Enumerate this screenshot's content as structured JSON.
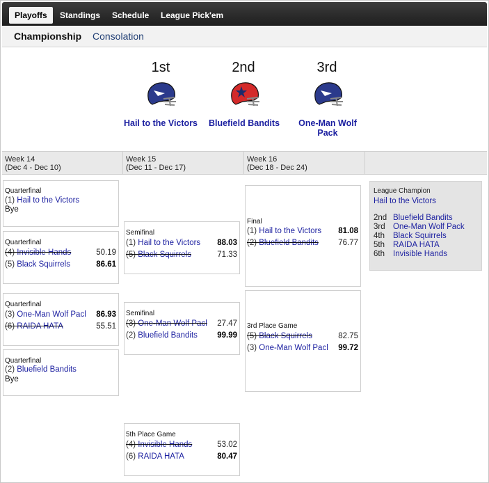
{
  "nav": {
    "tabs": [
      "Playoffs",
      "Standings",
      "Schedule",
      "League Pick'em"
    ]
  },
  "subnav": {
    "active": "Championship",
    "other": "Consolation"
  },
  "podium": [
    {
      "rank": "1st",
      "team": "Hail to the Victors",
      "helmet": "navy"
    },
    {
      "rank": "2nd",
      "team": "Bluefield Bandits",
      "helmet": "red"
    },
    {
      "rank": "3rd",
      "team": "One-Man Wolf Pack",
      "helmet": "navy"
    }
  ],
  "colors": {
    "navy_helmet": "#2b3a8c",
    "red_helmet": "#d42a2a",
    "link": "#1b1fa0"
  },
  "weeks": [
    {
      "title": "Week 14",
      "dates": "(Dec 4 - Dec 10)"
    },
    {
      "title": "Week 15",
      "dates": "(Dec 11 - Dec 17)"
    },
    {
      "title": "Week 16",
      "dates": "(Dec 18 - Dec 24)"
    }
  ],
  "matches": {
    "qf1": {
      "title": "Quarterfinal",
      "t1": {
        "seed": "(1)",
        "name": "Hail to the Victors"
      },
      "bye": "Bye"
    },
    "qf2": {
      "title": "Quarterfinal",
      "t1": {
        "seed": "(4)",
        "name": "Invisible Hands",
        "score": "50.19"
      },
      "t2": {
        "seed": "(5)",
        "name": "Black Squirrels",
        "score": "86.61"
      }
    },
    "qf3": {
      "title": "Quarterfinal",
      "t1": {
        "seed": "(3)",
        "name": "One-Man Wolf Pacl",
        "score": "86.93"
      },
      "t2": {
        "seed": "(6)",
        "name": "RAIDA HATA",
        "score": "55.51"
      }
    },
    "qf4": {
      "title": "Quarterfinal",
      "t1": {
        "seed": "(2)",
        "name": "Bluefield Bandits"
      },
      "bye": "Bye"
    },
    "sf1": {
      "title": "Semifinal",
      "t1": {
        "seed": "(1)",
        "name": "Hail to the Victors",
        "score": "88.03"
      },
      "t2": {
        "seed": "(5)",
        "name": "Black Squirrels",
        "score": "71.33"
      }
    },
    "sf2": {
      "title": "Semifinal",
      "t1": {
        "seed": "(3)",
        "name": "One-Man Wolf Pacl",
        "score": "27.47"
      },
      "t2": {
        "seed": "(2)",
        "name": "Bluefield Bandits",
        "score": "99.99"
      }
    },
    "fifth": {
      "title": "5th Place Game",
      "t1": {
        "seed": "(4)",
        "name": "Invisible Hands",
        "score": "53.02"
      },
      "t2": {
        "seed": "(6)",
        "name": "RAIDA HATA",
        "score": "80.47"
      }
    },
    "final": {
      "title": "Final",
      "t1": {
        "seed": "(1)",
        "name": "Hail to the Victors",
        "score": "81.08"
      },
      "t2": {
        "seed": "(2)",
        "name": "Bluefield Bandits",
        "score": "76.77"
      }
    },
    "third": {
      "title": "3rd Place Game",
      "t1": {
        "seed": "(5)",
        "name": "Black Squirrels",
        "score": "82.75"
      },
      "t2": {
        "seed": "(3)",
        "name": "One-Man Wolf Pacl",
        "score": "99.72"
      }
    }
  },
  "champion": {
    "title": "League Champion",
    "name": "Hail to the Victors",
    "places": [
      {
        "place": "2nd",
        "team": "Bluefield Bandits"
      },
      {
        "place": "3rd",
        "team": "One-Man Wolf Pack"
      },
      {
        "place": "4th",
        "team": "Black Squirrels"
      },
      {
        "place": "5th",
        "team": "RAIDA HATA"
      },
      {
        "place": "6th",
        "team": "Invisible Hands"
      }
    ]
  }
}
